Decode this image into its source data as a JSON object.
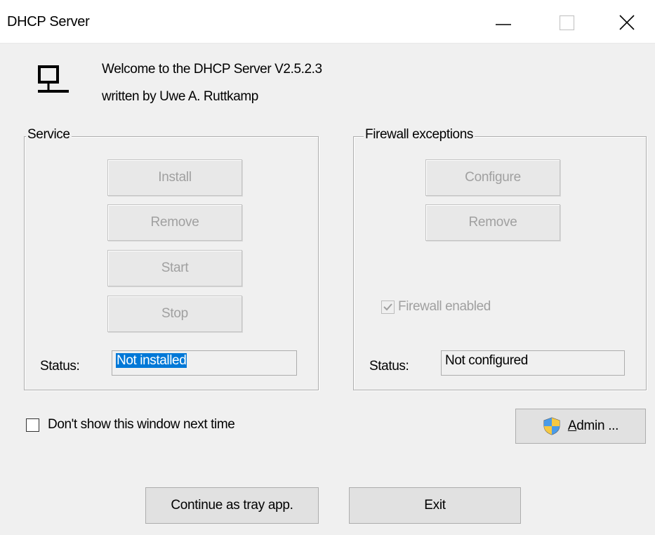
{
  "window": {
    "title": "DHCP Server",
    "minimize_icon": "minimize-icon",
    "maximize_icon": "maximize-icon",
    "close_icon": "close-icon"
  },
  "header": {
    "icon": "network-computer-icon",
    "line1": "Welcome to the DHCP Server V2.5.2.3",
    "line2": "written by Uwe A. Ruttkamp"
  },
  "service": {
    "legend": "Service",
    "install_label": "Install",
    "remove_label": "Remove",
    "start_label": "Start",
    "stop_label": "Stop",
    "status_label": "Status:",
    "status_value": "Not installed"
  },
  "firewall": {
    "legend": "Firewall exceptions",
    "configure_label": "Configure",
    "remove_label": "Remove",
    "enabled_label": "Firewall enabled",
    "enabled_checked": true,
    "status_label": "Status:",
    "status_value": "Not configured"
  },
  "options": {
    "dont_show_label": "Don't show this window next time",
    "dont_show_checked": false
  },
  "admin": {
    "icon": "uac-shield-icon",
    "label_first": "A",
    "label_rest": "dmin ..."
  },
  "footer": {
    "continue_label": "Continue as tray app.",
    "exit_label": "Exit"
  },
  "colors": {
    "selection": "#0078d7",
    "dialog_bg": "#f0f0f0",
    "disabled_text": "#a0a0a0"
  }
}
